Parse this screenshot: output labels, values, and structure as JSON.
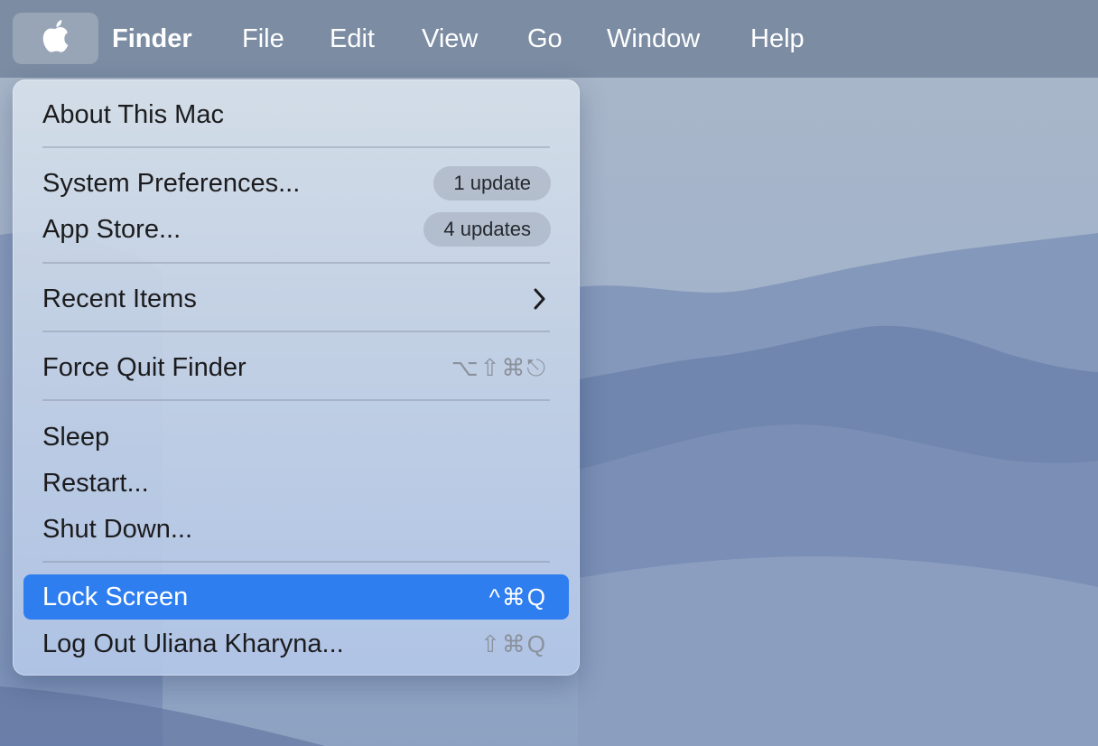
{
  "menubar": {
    "apple_icon": "apple-logo-icon",
    "app_name": "Finder",
    "menus": [
      "File",
      "Edit",
      "View",
      "Go",
      "Window",
      "Help"
    ]
  },
  "apple_menu": {
    "about": "About This Mac",
    "system_preferences": {
      "label": "System Preferences...",
      "badge": "1 update"
    },
    "app_store": {
      "label": "App Store...",
      "badge": "4 updates"
    },
    "recent_items": {
      "label": "Recent Items",
      "icon": "chevron-right-icon"
    },
    "force_quit": {
      "label": "Force Quit Finder",
      "shortcut": "⌥⇧⌘⎋"
    },
    "sleep": "Sleep",
    "restart": "Restart...",
    "shut_down": "Shut Down...",
    "lock_screen": {
      "label": "Lock Screen",
      "shortcut": "^⌘Q"
    },
    "log_out": {
      "label": "Log Out Uliana Kharyna...",
      "shortcut": "⇧⌘Q"
    }
  },
  "colors": {
    "selection": "#2f7ef0",
    "menubar": "#6e8098",
    "wallpaper_sky": "#a9b6c8",
    "wallpaper_mountains": "#6d82ac"
  }
}
